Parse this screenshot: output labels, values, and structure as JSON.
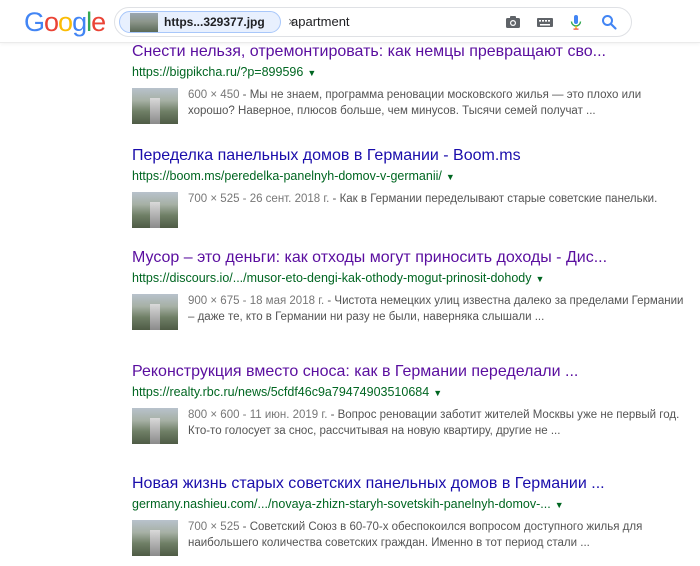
{
  "header": {
    "logo": [
      "G",
      "o",
      "o",
      "g",
      "l",
      "e"
    ],
    "logo_colors": [
      "#4285f4",
      "#ea4335",
      "#fbbc05",
      "#4285f4",
      "#34a853",
      "#ea4335"
    ],
    "image_chip": {
      "filename": "https...329377.jpg",
      "close": "×"
    },
    "query": "apartment",
    "icons": [
      "camera-icon",
      "keyboard-icon",
      "microphone-icon",
      "search-icon"
    ]
  },
  "results": [
    {
      "title": "Снести нельзя, отремонтировать: как немцы превращают сво...",
      "url": "https://bigpikcha.ru/?p=899596",
      "meta": "600 × 450",
      "snippet": " - Мы не знаем, программа реновации московского жилья — это плохо или хорошо? Наверное, плюсов больше, чем минусов. Тысячи семей получат ..."
    },
    {
      "title": "Переделка панельных домов в Германии - Boom.ms",
      "url": "https://boom.ms/peredelka-panelnyh-domov-v-germanii/",
      "meta": "700 × 525 - 26 сент. 2018 г.",
      "snippet": " - Как в Германии переделывают старые советские панельки."
    },
    {
      "title": "Мусор – это деньги: как отходы могут приносить доходы - Дис...",
      "url": "https://discours.io/.../musor-eto-dengi-kak-othody-mogut-prinosit-dohody",
      "meta": "900 × 675 - 18 мая 2018 г.",
      "snippet": " - Чистота немецких улиц известна далеко за пределами Германии – даже те, кто в Германии ни разу не были, наверняка слышали ..."
    },
    {
      "title": "Реконструкция вместо сноса: как в Германии переделали ...",
      "url": "https://realty.rbc.ru/news/5cfdf46c9a79474903510684",
      "meta": "800 × 600 - 11 июн. 2019 г.",
      "snippet": " - Вопрос реновации заботит жителей Москвы уже не первый год. Кто-то голосует за снос, рассчитывая на новую квартиру, другие не ..."
    },
    {
      "title": "Новая жизнь старых советских панельных домов в Германии ...",
      "url": "germany.nashieu.com/.../novaya-zhizn-staryh-sovetskih-panelnyh-domov-...",
      "meta": "700 × 525",
      "snippet": " - Советский Союз в 60-70-х обеспокоился вопросом доступного жилья для наибольшего количества советских граждан. Именно в тот период стали ..."
    }
  ],
  "colors": {
    "visited_link": "#5a0e9f",
    "link": "#1a0dab",
    "url_green": "#006621",
    "snippet": "#545454"
  }
}
